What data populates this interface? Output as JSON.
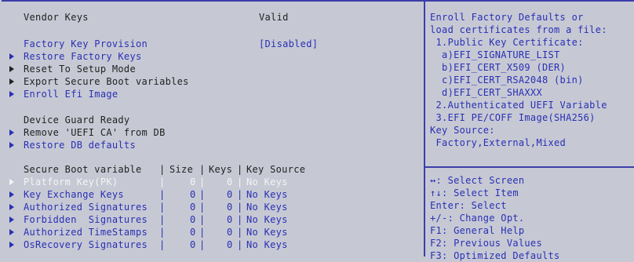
{
  "vendor_keys": {
    "label": "Vendor Keys",
    "value": "Valid"
  },
  "factory_key_provision": {
    "label": "Factory Key Provision",
    "value": "[Disabled]"
  },
  "menu": {
    "restore_factory_keys": "Restore Factory Keys",
    "reset_to_setup_mode": "Reset To Setup Mode",
    "export_secure_boot_variables": "Export Secure Boot variables",
    "enroll_efi_image": "Enroll Efi Image",
    "device_guard_ready": "Device Guard Ready",
    "remove_uefi_ca": "Remove 'UEFI CA' from DB",
    "restore_db_defaults": "Restore DB defaults"
  },
  "table": {
    "headers": [
      "Secure Boot variable",
      "Size",
      "Keys",
      "Key Source"
    ],
    "rows": [
      {
        "name": "Platform Key(PK)",
        "size": "0",
        "keys": "0",
        "source": "No Keys"
      },
      {
        "name": "Key Exchange Keys",
        "size": "0",
        "keys": "0",
        "source": "No Keys"
      },
      {
        "name": "Authorized Signatures",
        "size": "0",
        "keys": "0",
        "source": "No Keys"
      },
      {
        "name": "Forbidden  Signatures",
        "size": "0",
        "keys": "0",
        "source": "No Keys"
      },
      {
        "name": "Authorized TimeStamps",
        "size": "0",
        "keys": "0",
        "source": "No Keys"
      },
      {
        "name": "OsRecovery Signatures",
        "size": "0",
        "keys": "0",
        "source": "No Keys"
      }
    ]
  },
  "help_text": [
    "Enroll Factory Defaults or",
    "load certificates from a file:",
    " 1.Public Key Certificate:",
    "  a)EFI_SIGNATURE_LIST",
    "  b)EFI_CERT_X509 (DER)",
    "  c)EFI_CERT_RSA2048 (bin)",
    "  d)EFI_CERT_SHAXXX",
    " 2.Authenticated UEFI Variable",
    " 3.EFI PE/COFF Image(SHA256)",
    "Key Source:",
    " Factory,External,Mixed"
  ],
  "keys_help": [
    "↔: Select Screen",
    "↑↓: Select Item",
    "Enter: Select",
    "+/-: Change Opt.",
    "F1: General Help",
    "F2: Previous Values",
    "F3: Optimized Defaults"
  ],
  "colors": {
    "background": "#c6c9d4",
    "accent": "#2a2fb4",
    "text": "#222222",
    "highlight": "#f4f4f4"
  }
}
